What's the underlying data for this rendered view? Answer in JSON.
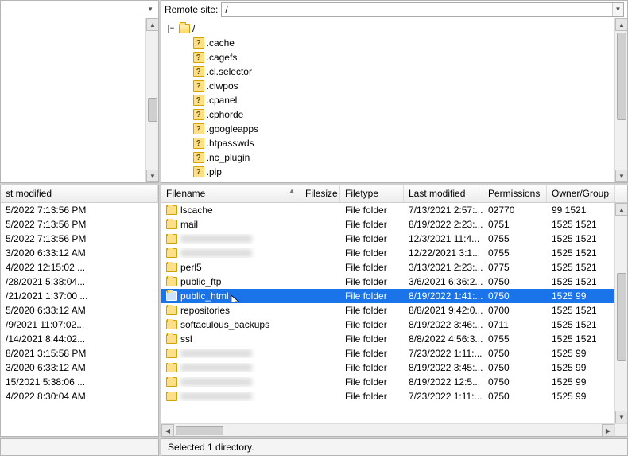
{
  "left_top": {
    "header": ""
  },
  "remote": {
    "label": "Remote site:",
    "path": "/"
  },
  "tree": {
    "root": "/",
    "children": [
      ".cache",
      ".cagefs",
      ".cl.selector",
      ".clwpos",
      ".cpanel",
      ".cphorde",
      ".googleapps",
      ".htpasswds",
      ".nc_plugin",
      ".pip"
    ]
  },
  "left_list": {
    "header": "st modified",
    "rows": [
      "5/2022 7:13:56 PM",
      "5/2022 7:13:56 PM",
      "5/2022 7:13:56 PM",
      "3/2020 6:33:12 AM",
      "4/2022 12:15:02 ...",
      "/28/2021 5:38:04...",
      "/21/2021 1:37:00 ...",
      "5/2020 6:33:12 AM",
      "/9/2021 11:07:02...",
      "/14/2021 8:44:02...",
      "8/2021 3:15:58 PM",
      "3/2020 6:33:12 AM",
      "15/2021 5:38:06 ...",
      "4/2022 8:30:04 AM"
    ]
  },
  "columns": {
    "filename": "Filename",
    "filesize": "Filesize",
    "filetype": "Filetype",
    "lastmod": "Last modified",
    "permissions": "Permissions",
    "owner": "Owner/Group"
  },
  "files": [
    {
      "name": "lscache",
      "blur": false,
      "type": "File folder",
      "mod": "7/13/2021 2:57:...",
      "perm": "02770",
      "own": "99 1521"
    },
    {
      "name": "mail",
      "blur": false,
      "type": "File folder",
      "mod": "8/19/2022 2:23:...",
      "perm": "0751",
      "own": "1525 1521"
    },
    {
      "name": "",
      "blur": true,
      "type": "File folder",
      "mod": "12/3/2021 11:4...",
      "perm": "0755",
      "own": "1525 1521"
    },
    {
      "name": "",
      "blur": true,
      "type": "File folder",
      "mod": "12/22/2021 3:1...",
      "perm": "0755",
      "own": "1525 1521"
    },
    {
      "name": "perl5",
      "blur": false,
      "type": "File folder",
      "mod": "3/13/2021 2:23:...",
      "perm": "0775",
      "own": "1525 1521"
    },
    {
      "name": "public_ftp",
      "blur": false,
      "type": "File folder",
      "mod": "3/6/2021 6:36:2...",
      "perm": "0750",
      "own": "1525 1521"
    },
    {
      "name": "public_html",
      "blur": false,
      "type": "File folder",
      "mod": "8/19/2022 1:41:...",
      "perm": "0750",
      "own": "1525 99",
      "selected": true,
      "cursor": true
    },
    {
      "name": "repositories",
      "blur": false,
      "type": "File folder",
      "mod": "8/8/2021 9:42:0...",
      "perm": "0700",
      "own": "1525 1521"
    },
    {
      "name": "softaculous_backups",
      "blur": false,
      "type": "File folder",
      "mod": "8/19/2022 3:46:...",
      "perm": "0711",
      "own": "1525 1521"
    },
    {
      "name": "ssl",
      "blur": false,
      "type": "File folder",
      "mod": "8/8/2022 4:56:3...",
      "perm": "0755",
      "own": "1525 1521"
    },
    {
      "name": "",
      "blur": true,
      "type": "File folder",
      "mod": "7/23/2022 1:11:...",
      "perm": "0750",
      "own": "1525 99"
    },
    {
      "name": "",
      "blur": true,
      "type": "File folder",
      "mod": "8/19/2022 3:45:...",
      "perm": "0750",
      "own": "1525 99"
    },
    {
      "name": "",
      "blur": true,
      "type": "File folder",
      "mod": "8/19/2022 12:5...",
      "perm": "0750",
      "own": "1525 99"
    },
    {
      "name": "",
      "blur": true,
      "type": "File folder",
      "mod": "7/23/2022 1:11:...",
      "perm": "0750",
      "own": "1525 99"
    }
  ],
  "status": "Selected 1 directory."
}
